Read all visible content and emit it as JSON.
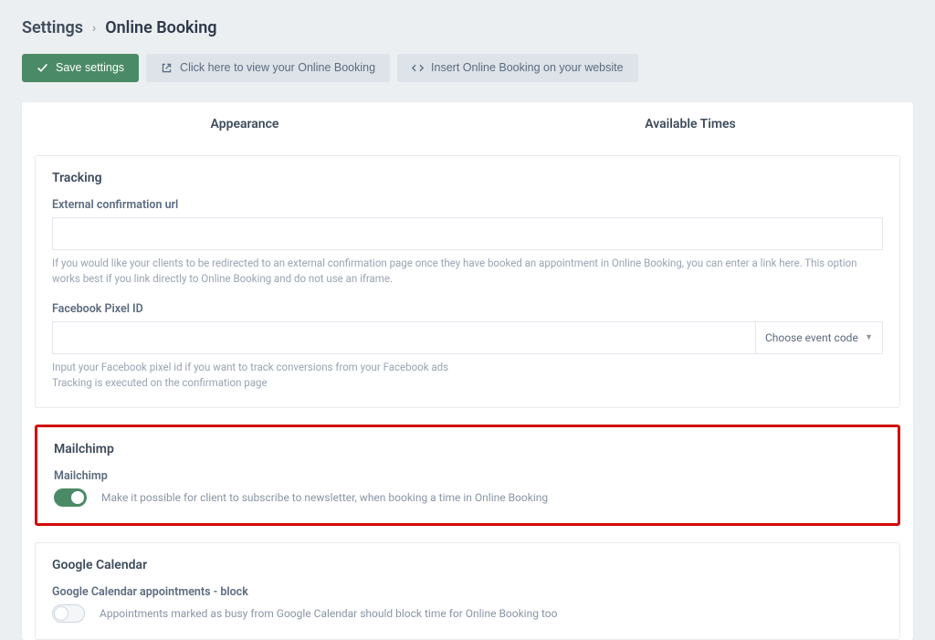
{
  "breadcrumb": {
    "root": "Settings",
    "current": "Online Booking"
  },
  "buttons": {
    "save": "Save settings",
    "view": "Click here to view your Online Booking",
    "insert": "Insert Online Booking on your website"
  },
  "tabs": {
    "appearance": "Appearance",
    "available_times": "Available Times"
  },
  "tracking": {
    "title": "Tracking",
    "external_url_label": "External confirmation url",
    "external_url_value": "",
    "external_url_help": "If you would like your clients to be redirected to an external confirmation page once they have booked an appointment in Online Booking, you can enter a link here. This option works best if you link directly to Online Booking and do not use an iframe.",
    "pixel_label": "Facebook Pixel ID",
    "pixel_value": "",
    "pixel_select": "Choose event code",
    "pixel_help_1": "Input your Facebook pixel id if you want to track conversions from your Facebook ads",
    "pixel_help_2": "Tracking is executed on the confirmation page"
  },
  "mailchimp": {
    "title": "Mailchimp",
    "label": "Mailchimp",
    "toggle_on": true,
    "description": "Make it possible for client to subscribe to newsletter, when booking a time in Online Booking"
  },
  "gcal": {
    "title": "Google Calendar",
    "label": "Google Calendar appointments - block",
    "toggle_on": false,
    "description": "Appointments marked as busy from Google Calendar should block time for Online Booking too"
  }
}
